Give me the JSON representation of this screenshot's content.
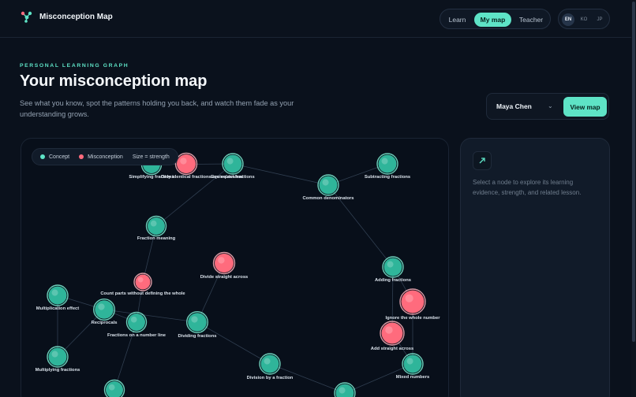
{
  "header": {
    "brand_title": "Misconception Map",
    "nav": [
      {
        "label": "Learn",
        "active": false
      },
      {
        "label": "My map",
        "active": true
      },
      {
        "label": "Teacher",
        "active": false
      }
    ],
    "languages": [
      {
        "label": "EN",
        "active": true
      },
      {
        "label": "KO",
        "active": false
      },
      {
        "label": "JP",
        "active": false
      }
    ]
  },
  "hero": {
    "eyebrow": "PERSONAL LEARNING GRAPH",
    "title": "Your misconception map",
    "subtitle": "See what you know, spot the patterns holding you back, and watch them fade as your understanding grows."
  },
  "student_picker": {
    "selected": "Maya Chen",
    "button_label": "View map"
  },
  "legend": {
    "concept_label": "Concept",
    "misconception_label": "Misconception",
    "size_label": "Size = strength"
  },
  "colors": {
    "accent": "#5ee3c6",
    "concept": "#2fb59a",
    "misconception": "#ff6b7d"
  },
  "graph": {
    "nodes": [
      {
        "id": "simplifying",
        "label": "Simplifying fractions",
        "kind": "concept",
        "strength": 0.5
      },
      {
        "id": "equiv_equal",
        "label": "Only identical fractions are equivalent",
        "kind": "misconception",
        "strength": 0.6
      },
      {
        "id": "equivalent",
        "label": "Equivalent fractions",
        "kind": "concept",
        "strength": 0.55
      },
      {
        "id": "subtracting",
        "label": "Subtracting fractions",
        "kind": "concept",
        "strength": 0.55
      },
      {
        "id": "common_den",
        "label": "Common denominators",
        "kind": "concept",
        "strength": 0.55
      },
      {
        "id": "meaning",
        "label": "Fraction meaning",
        "kind": "concept",
        "strength": 0.5
      },
      {
        "id": "divide_across",
        "label": "Divide straight across",
        "kind": "misconception",
        "strength": 0.6
      },
      {
        "id": "count_parts",
        "label": "Count parts without defining the whole",
        "kind": "misconception",
        "strength": 0.35
      },
      {
        "id": "adding",
        "label": "Adding fractions",
        "kind": "concept",
        "strength": 0.55
      },
      {
        "id": "ignore_whole",
        "label": "Ignore the whole number",
        "kind": "misconception",
        "strength": 0.85
      },
      {
        "id": "mult_effect",
        "label": "Multiplication effect",
        "kind": "concept",
        "strength": 0.55
      },
      {
        "id": "reciprocals",
        "label": "Reciprocals",
        "kind": "concept",
        "strength": 0.58
      },
      {
        "id": "number_line",
        "label": "Fractions on a number line",
        "kind": "concept",
        "strength": 0.5
      },
      {
        "id": "dividing",
        "label": "Dividing fractions",
        "kind": "concept",
        "strength": 0.58
      },
      {
        "id": "add_across",
        "label": "Add straight across",
        "kind": "misconception",
        "strength": 0.75
      },
      {
        "id": "multiplying",
        "label": "Multiplying fractions",
        "kind": "concept",
        "strength": 0.55
      },
      {
        "id": "div_by_fraction",
        "label": "Division by a fraction",
        "kind": "concept",
        "strength": 0.55
      },
      {
        "id": "mixed",
        "label": "Mixed numbers",
        "kind": "concept",
        "strength": 0.55
      },
      {
        "id": "bottom_a",
        "label": "",
        "kind": "concept",
        "strength": 0.5
      },
      {
        "id": "bottom_b",
        "label": "",
        "kind": "concept",
        "strength": 0.55
      }
    ],
    "edges": [
      [
        "simplifying",
        "equivalent"
      ],
      [
        "equivalent",
        "common_den"
      ],
      [
        "common_den",
        "subtracting"
      ],
      [
        "common_den",
        "adding"
      ],
      [
        "equivalent",
        "meaning"
      ],
      [
        "meaning",
        "count_parts"
      ],
      [
        "count_parts",
        "number_line"
      ],
      [
        "reciprocals",
        "number_line"
      ],
      [
        "reciprocals",
        "dividing"
      ],
      [
        "reciprocals",
        "mult_effect"
      ],
      [
        "mult_effect",
        "multiplying"
      ],
      [
        "reciprocals",
        "multiplying"
      ],
      [
        "divide_across",
        "dividing"
      ],
      [
        "dividing",
        "div_by_fraction"
      ],
      [
        "div_by_fraction",
        "bottom_b"
      ],
      [
        "adding",
        "ignore_whole"
      ],
      [
        "adding",
        "add_across"
      ],
      [
        "ignore_whole",
        "mixed"
      ],
      [
        "add_across",
        "mixed"
      ],
      [
        "mixed",
        "bottom_b"
      ],
      [
        "number_line",
        "bottom_a"
      ]
    ]
  },
  "detail": {
    "placeholder": "Select a node to explore its learning evidence, strength, and related lesson."
  }
}
